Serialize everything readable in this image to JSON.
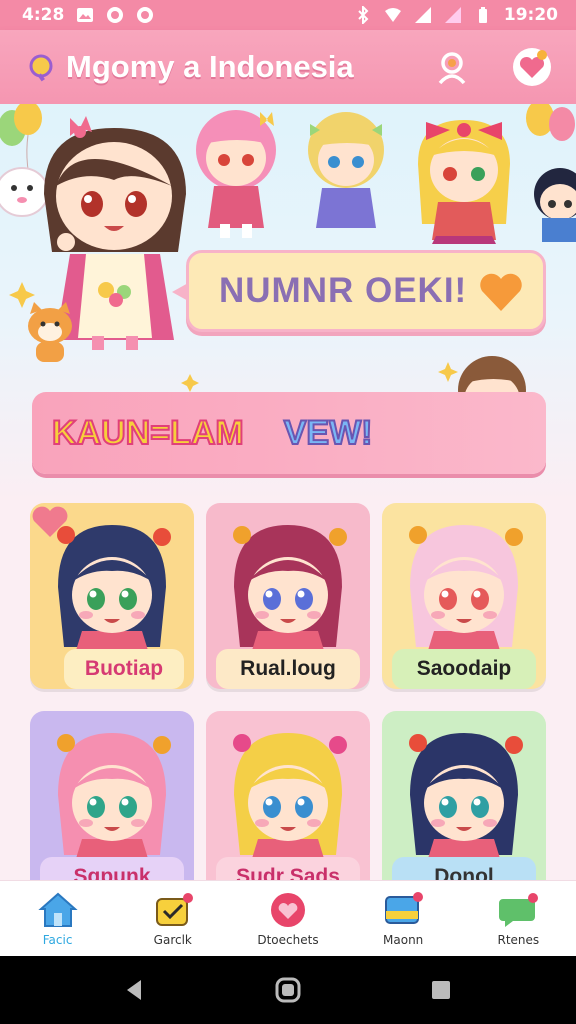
{
  "status_bar": {
    "time": "4:28",
    "clock_right": "19:20"
  },
  "app_bar": {
    "title": "Mgomy a Indonesia"
  },
  "hero": {
    "speech_text": "NUMNR OEKI!",
    "banner_text_a": "KAUN=LAM",
    "banner_text_b": "VEW!"
  },
  "cards": [
    {
      "label": "Buotiap",
      "bg": "#fbd98c",
      "label_bg": "#fdeec2",
      "label_color": "#d63a73",
      "hair": "#2f3a6b",
      "eyes": "#3aa05a",
      "accent": "#e84d3a"
    },
    {
      "label": "Rual.loug",
      "bg": "#f7bacb",
      "label_bg": "#fde9c7",
      "label_color": "#222222",
      "hair": "#a8345a",
      "eyes": "#5a6fd8",
      "accent": "#f0a12c"
    },
    {
      "label": "Saoodaip",
      "bg": "#fbe3a0",
      "label_bg": "#d7f0b8",
      "label_color": "#222222",
      "hair": "#f7c6dd",
      "eyes": "#e55a5a",
      "accent": "#f0a12c"
    },
    {
      "label": "Sqpunk",
      "bg": "#c9b8ef",
      "label_bg": "#e6d2f7",
      "label_color": "#c9306a",
      "hair": "#f58fb0",
      "eyes": "#2fa58a",
      "accent": "#f0a12c"
    },
    {
      "label": "Sudr Sads",
      "bg": "#f9c2d2",
      "label_bg": "#fbd3de",
      "label_color": "#c9306a",
      "hair": "#f4cf47",
      "eyes": "#3a8fd0",
      "accent": "#e64a8a"
    },
    {
      "label": "Donol",
      "bg": "#cdeec4",
      "label_bg": "#b9e0f5",
      "label_color": "#333333",
      "hair": "#2b3568",
      "eyes": "#2f9fa3",
      "accent": "#e84d3a"
    }
  ],
  "bottom_nav": [
    {
      "label": "Facic",
      "icon": "home-icon",
      "active": true
    },
    {
      "label": "Garclk",
      "icon": "check-badge-icon",
      "active": false
    },
    {
      "label": "Dtoechets",
      "icon": "heart-circle-icon",
      "active": false
    },
    {
      "label": "Maonn",
      "icon": "inbox-icon",
      "active": false
    },
    {
      "label": "Rtenes",
      "icon": "chat-icon",
      "active": false
    }
  ],
  "colors": {
    "primary_pink": "#f596b1",
    "active_nav": "#2ea8e0"
  }
}
